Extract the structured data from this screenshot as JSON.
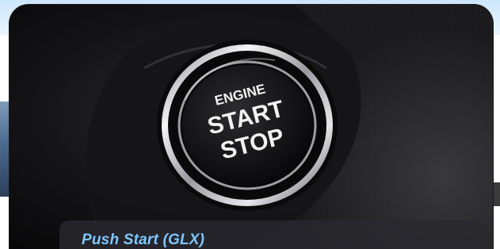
{
  "photo": {
    "button_line_1": "ENGINE",
    "button_line_2": "START",
    "button_line_3": "STOP"
  },
  "caption": {
    "text": "Push Start (GLX)"
  },
  "colors": {
    "caption_text": "#7fc7ff",
    "caption_background": "#28282e",
    "button_chrome": "#d8d8dc",
    "button_face": "#111114"
  }
}
